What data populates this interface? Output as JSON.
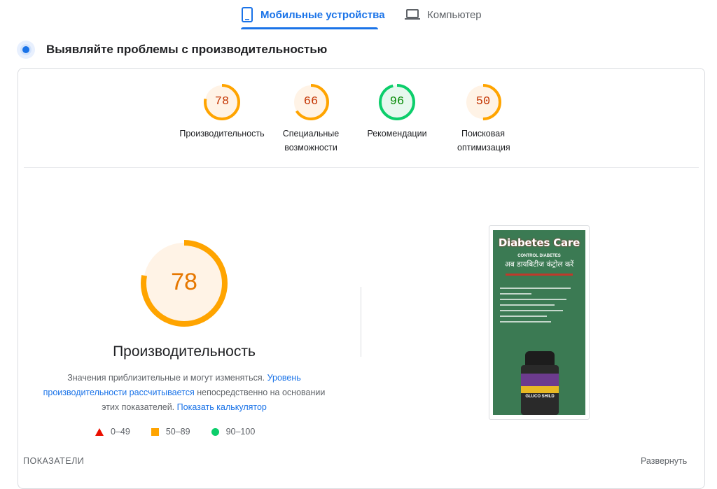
{
  "tabs": {
    "mobile": "Мобильные устройства",
    "desktop": "Компьютер"
  },
  "section": {
    "title": "Выявляйте проблемы с производительностью"
  },
  "scores": [
    {
      "value": "78",
      "label": "Производительность",
      "status": "average",
      "fraction": 0.78,
      "color": "#ffa400"
    },
    {
      "value": "66",
      "label": "Специальные возможности",
      "status": "average",
      "fraction": 0.66,
      "color": "#ffa400"
    },
    {
      "value": "96",
      "label": "Рекомендации",
      "status": "pass",
      "fraction": 0.96,
      "color": "#0cce6b"
    },
    {
      "value": "50",
      "label": "Поисковая оптимизация",
      "status": "average",
      "fraction": 0.5,
      "color": "#ffa400"
    }
  ],
  "main": {
    "score": "78",
    "score_fraction": 0.78,
    "title": "Производительность",
    "note": {
      "text1": "Значения приблизительные и могут изменяться.",
      "link1": "Уровень производительности рассчитывается",
      "text2": "непосредственно на основании этих показателей.",
      "link2": "Показать калькулятор"
    },
    "legend": [
      {
        "range": "0–49",
        "shape": "triangle",
        "color": "#eb0f00"
      },
      {
        "range": "50–89",
        "shape": "square",
        "color": "#ffa400"
      },
      {
        "range": "90–100",
        "shape": "circle",
        "color": "#0cce6b"
      }
    ]
  },
  "screenshot": {
    "title": "Diabetes Care",
    "subtitle": "CONTROL DIABETES",
    "hindi": "अब डायबिटीज कंट्रोल करें",
    "product": "GLUCO SHILD"
  },
  "footer": {
    "metrics": "ПОКАЗАТЕЛИ",
    "expand": "Развернуть"
  },
  "colors": {
    "accent": "#1a73e8",
    "average": "#ffa400",
    "pass": "#0cce6b",
    "fail": "#eb0f00"
  }
}
